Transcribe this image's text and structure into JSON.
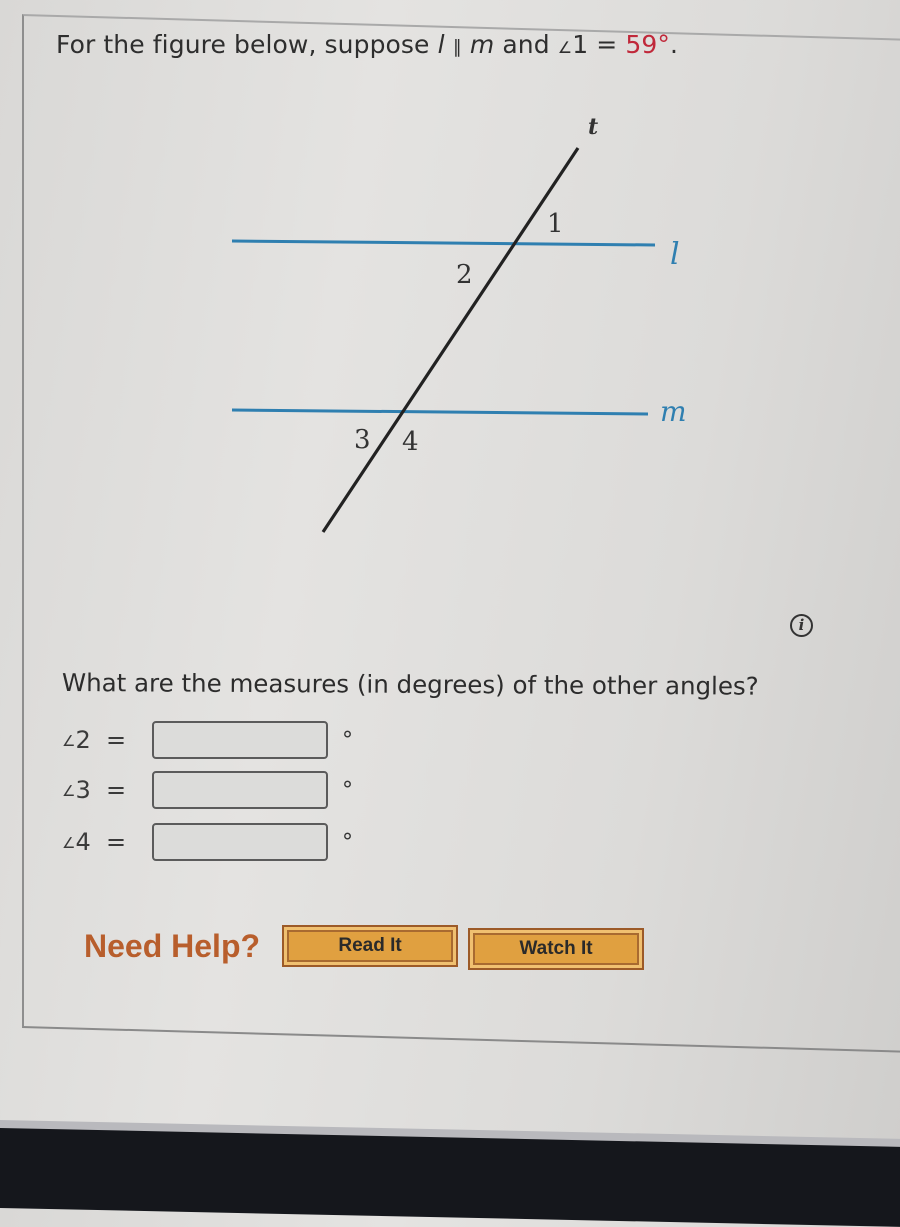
{
  "prompt": {
    "prefix": "For the figure below, suppose ",
    "line_l": "l",
    "parallel_symbol": "∥",
    "line_m": "m",
    "middle": " and ",
    "angle_symbol": "∠",
    "given_angle": "1",
    "equals": " = ",
    "given_value": "59°",
    "suffix": "."
  },
  "figure": {
    "line_labels": {
      "transversal": "t",
      "top": "l",
      "bottom": "m"
    },
    "angle_labels": [
      "1",
      "2",
      "3",
      "4"
    ],
    "colors": {
      "parallel_lines": "#2f7fb0",
      "transversal": "#222222"
    }
  },
  "info_icon": {
    "glyph": "i"
  },
  "question": "What are the measures (in degrees) of the other angles?",
  "answers": [
    {
      "angle_symbol": "∠",
      "angle": "2",
      "equals": "=",
      "value": "",
      "unit": "°"
    },
    {
      "angle_symbol": "∠",
      "angle": "3",
      "equals": "=",
      "value": "",
      "unit": "°"
    },
    {
      "angle_symbol": "∠",
      "angle": "4",
      "equals": "=",
      "value": "",
      "unit": "°"
    }
  ],
  "help": {
    "label": "Need Help?",
    "read_button": "Read It",
    "watch_button": "Watch It"
  },
  "colors": {
    "accent_red": "#c0283a",
    "help_orange": "#b85e2c",
    "button_fill": "#e0a040"
  }
}
